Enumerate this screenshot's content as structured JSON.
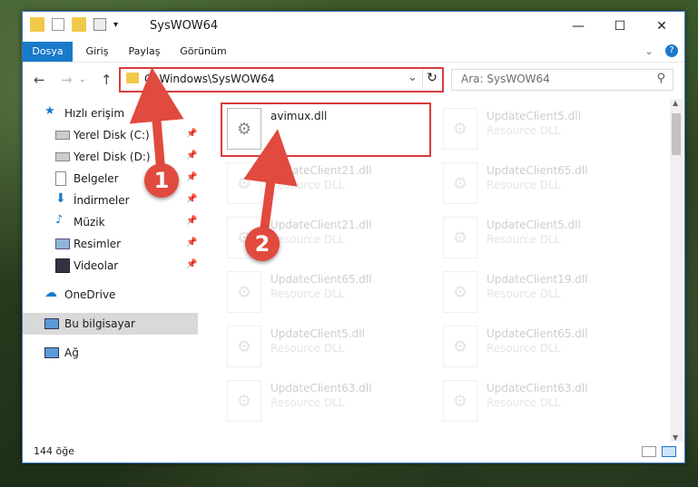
{
  "window": {
    "title": "SysWOW64",
    "minimize_glyph": "—",
    "maximize_glyph": "☐",
    "close_glyph": "✕"
  },
  "ribbon": {
    "tabs": [
      "Dosya",
      "Giriş",
      "Paylaş",
      "Görünüm"
    ],
    "expand_glyph": "⌄",
    "help_glyph": "?"
  },
  "nav": {
    "back_glyph": "←",
    "forward_glyph": "→",
    "up_glyph": "↑",
    "address": "C:\\Windows\\SysWOW64",
    "dropdown_glyph": "⌄",
    "refresh_glyph": "↻",
    "search_placeholder": "Ara: SysWOW64",
    "search_glyph": "⚲"
  },
  "sidebar": {
    "items": [
      {
        "label": "Hızlı erişim",
        "icon": "star-icon"
      },
      {
        "label": "Yerel Disk (C:)",
        "icon": "drive-icon",
        "pinned": true
      },
      {
        "label": "Yerel Disk (D:)",
        "icon": "drive-icon",
        "pinned": true
      },
      {
        "label": "Belgeler",
        "icon": "documents-icon",
        "pinned": true
      },
      {
        "label": "İndirmeler",
        "icon": "downloads-icon",
        "pinned": true
      },
      {
        "label": "Müzik",
        "icon": "music-icon",
        "pinned": true
      },
      {
        "label": "Resimler",
        "icon": "pictures-icon",
        "pinned": true
      },
      {
        "label": "Videolar",
        "icon": "videos-icon",
        "pinned": true
      },
      {
        "label": "OneDrive",
        "icon": "cloud-icon"
      },
      {
        "label": "Bu bilgisayar",
        "icon": "computer-icon",
        "selected": true
      },
      {
        "label": "Ağ",
        "icon": "network-icon"
      }
    ]
  },
  "files": [
    {
      "name": "avimux.dll",
      "type": ""
    },
    {
      "name": "UpdateClient5.dll",
      "type": "Resource DLL"
    },
    {
      "name": "UpdateClient21.dll",
      "type": "Resource DLL"
    },
    {
      "name": "UpdateClient65.dll",
      "type": "Resource DLL"
    },
    {
      "name": "UpdateClient21.dll",
      "type": "Resource DLL"
    },
    {
      "name": "UpdateClient5.dll",
      "type": "Resource DLL"
    },
    {
      "name": "UpdateClient65.dll",
      "type": "Resource DLL"
    },
    {
      "name": "UpdateClient19.dll",
      "type": "Resource DLL"
    },
    {
      "name": "UpdateClient5.dll",
      "type": "Resource DLL"
    },
    {
      "name": "UpdateClient65.dll",
      "type": "Resource DLL"
    },
    {
      "name": "UpdateClient63.dll",
      "type": "Resource DLL"
    },
    {
      "name": "UpdateClient63.dll",
      "type": "Resource DLL"
    }
  ],
  "status": {
    "count": "144 öğe"
  },
  "annotations": {
    "badge1": "1",
    "badge2": "2"
  },
  "colors": {
    "accent": "#1979ca",
    "highlight": "#d63d3d"
  }
}
